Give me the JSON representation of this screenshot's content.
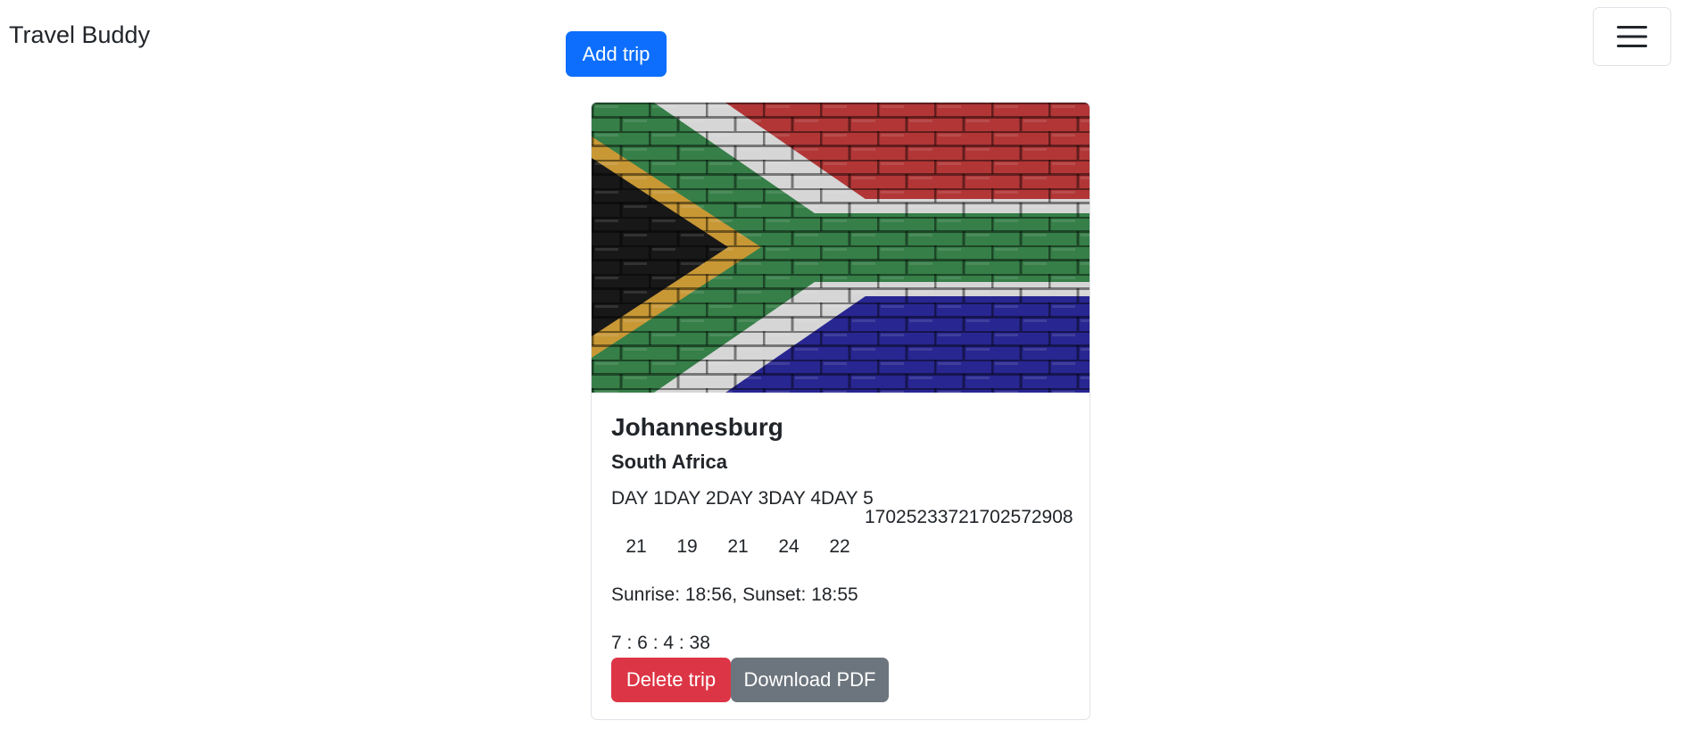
{
  "navbar": {
    "brand": "Travel Buddy",
    "menu_icon": "hamburger-menu-icon"
  },
  "actions": {
    "add_trip_label": "Add trip"
  },
  "colors": {
    "primary": "#0d6efd",
    "danger": "#dc3545",
    "secondary": "#6c757d",
    "flag_red": "#c23b3b",
    "flag_blue": "#2c2a9e",
    "flag_green": "#3b8a4f",
    "flag_gold": "#d9a53a"
  },
  "trip": {
    "image_alt": "South Africa flag painted on brick wall",
    "city": "Johannesburg",
    "country": "South Africa",
    "forecast": {
      "days_header": "DAY 1DAY 2DAY 3DAY 4DAY 5",
      "timestamps": "17025233721702572908",
      "temperatures": [
        "21",
        "19",
        "21",
        "24",
        "22"
      ]
    },
    "sun_info": "Sunrise: 18:56, Sunset: 18:55",
    "countdown": "7 : 6 : 4 : 38",
    "delete_label": "Delete trip",
    "download_label": "Download PDF"
  }
}
